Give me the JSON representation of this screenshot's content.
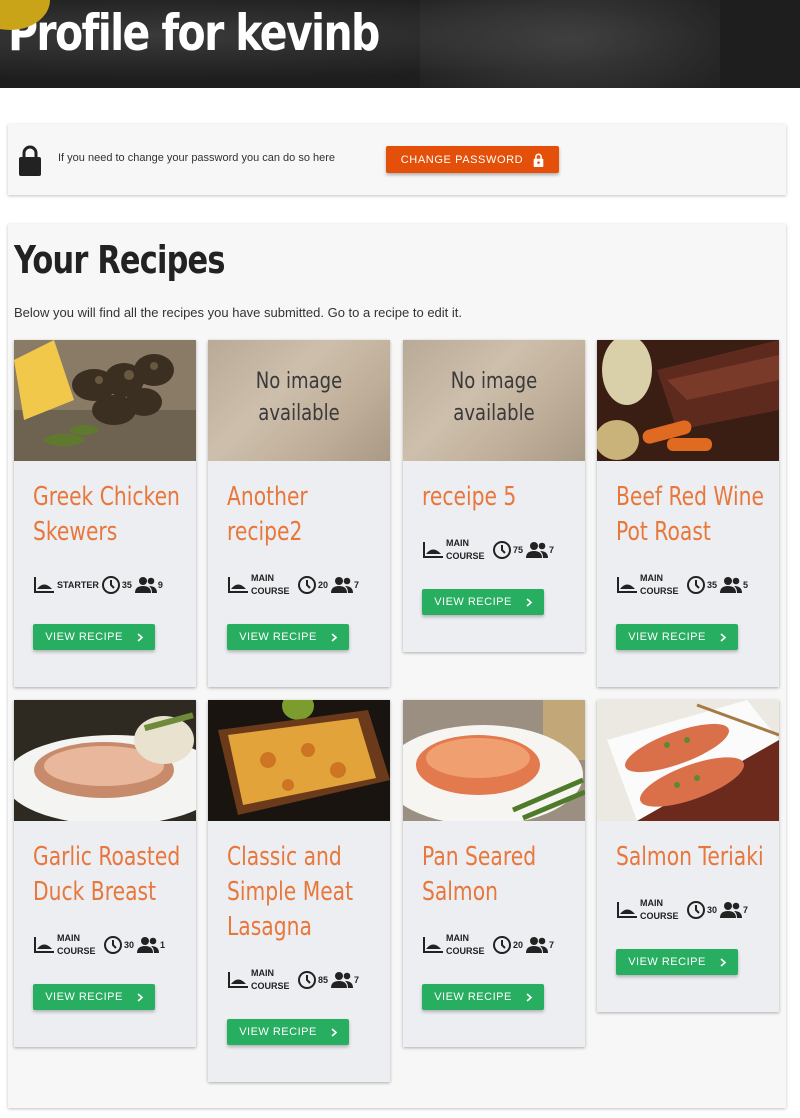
{
  "header": {
    "title": "Profile for kevinb"
  },
  "password": {
    "text": "If you need to change your password you can do so here",
    "button_label": "CHANGE PASSWORD"
  },
  "recipes": {
    "heading": "Your Recipes",
    "subtitle": "Below you will find all the recipes you have submitted. Go to a recipe to edit it.",
    "button_label": "VIEW RECIPE",
    "no_image_line1": "No image",
    "no_image_line2": "available",
    "items": [
      {
        "title_lines": [
          "Greek Chicken",
          "Skewers"
        ],
        "course": "STARTER",
        "course_lines": [
          "STARTER"
        ],
        "time": "35",
        "serves": "9",
        "image": "chicken-skewers"
      },
      {
        "title_lines": [
          "Another",
          "recipe2"
        ],
        "course": "MAIN COURSE",
        "course_lines": [
          "MAIN",
          "COURSE"
        ],
        "time": "20",
        "serves": "7",
        "image": "no-image"
      },
      {
        "title_lines": [
          "receipe 5"
        ],
        "course": "MAIN COURSE",
        "course_lines": [
          "MAIN",
          "COURSE"
        ],
        "time": "75",
        "serves": "7",
        "image": "no-image"
      },
      {
        "title_lines": [
          "Beef Red Wine",
          "Pot Roast"
        ],
        "course": "MAIN COURSE",
        "course_lines": [
          "MAIN",
          "COURSE"
        ],
        "time": "35",
        "serves": "5",
        "image": "pot-roast"
      },
      {
        "title_lines": [
          "Garlic Roasted",
          "Duck Breast"
        ],
        "course": "MAIN COURSE",
        "course_lines": [
          "MAIN",
          "COURSE"
        ],
        "time": "30",
        "serves": "1",
        "image": "duck-breast"
      },
      {
        "title_lines": [
          "Classic and",
          "Simple Meat",
          "Lasagna"
        ],
        "course": "MAIN COURSE",
        "course_lines": [
          "MAIN",
          "COURSE"
        ],
        "time": "85",
        "serves": "7",
        "image": "lasagna"
      },
      {
        "title_lines": [
          "Pan Seared",
          "Salmon"
        ],
        "course": "MAIN COURSE",
        "course_lines": [
          "MAIN",
          "COURSE"
        ],
        "time": "20",
        "serves": "7",
        "image": "salmon"
      },
      {
        "title_lines": [
          "Salmon Teriaki"
        ],
        "course": "MAIN COURSE",
        "course_lines": [
          "MAIN",
          "COURSE"
        ],
        "time": "30",
        "serves": "7",
        "image": "salmon-teriyaki"
      }
    ]
  },
  "colors": {
    "accent_orange": "#e4500a",
    "title_orange": "#e8773c",
    "button_green": "#27ae60",
    "card_bg": "#eceef1"
  },
  "icons": [
    "lock-icon",
    "course-icon",
    "clock-icon",
    "people-icon",
    "chevron-right-icon"
  ]
}
